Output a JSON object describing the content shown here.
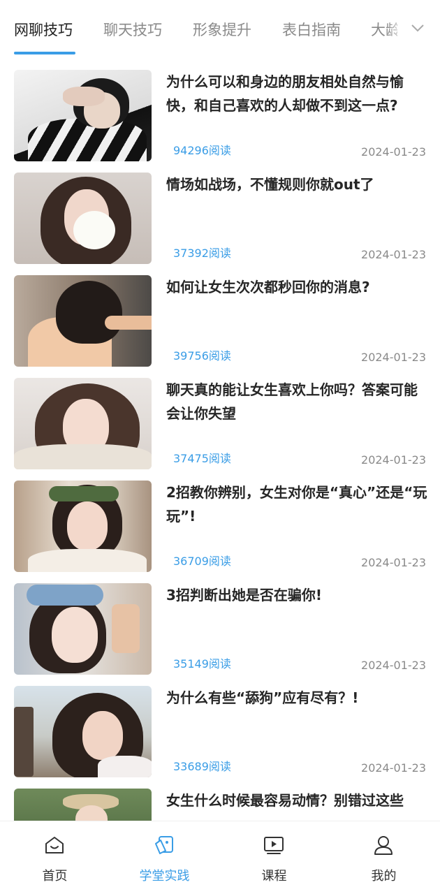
{
  "tabs": {
    "items": [
      "网聊技巧",
      "聊天技巧",
      "形象提升",
      "表白指南",
      "大龄"
    ],
    "active_index": 0,
    "more_icon": "chevron-down-icon"
  },
  "articles": [
    {
      "title": "为什么可以和身边的朋友相处自然与愉快，和自己喜欢的人却做不到这一点?",
      "reads": "94296阅读",
      "date": "2024-01-23"
    },
    {
      "title": "情场如战场，不懂规则你就out了",
      "reads": "37392阅读",
      "date": "2024-01-23"
    },
    {
      "title": "如何让女生次次都秒回你的消息?",
      "reads": "39756阅读",
      "date": "2024-01-23"
    },
    {
      "title": "聊天真的能让女生喜欢上你吗？答案可能会让你失望",
      "reads": "37475阅读",
      "date": "2024-01-23"
    },
    {
      "title": "2招教你辨别，女生对你是“真心”还是“玩玩”!",
      "reads": "36709阅读",
      "date": "2024-01-23"
    },
    {
      "title": "3招判断出她是否在骗你!",
      "reads": "35149阅读",
      "date": "2024-01-23"
    },
    {
      "title": "为什么有些“舔狗”应有尽有？!",
      "reads": "33689阅读",
      "date": "2024-01-23"
    },
    {
      "title": "女生什么时候最容易动情？别错过这些",
      "reads": "",
      "date": ""
    }
  ],
  "bottom_nav": {
    "items": [
      {
        "label": "首页",
        "icon": "home-icon"
      },
      {
        "label": "学堂实践",
        "icon": "practice-icon"
      },
      {
        "label": "课程",
        "icon": "video-play-icon"
      },
      {
        "label": "我的",
        "icon": "user-icon"
      }
    ],
    "active_index": 1
  },
  "colors": {
    "accent": "#3a9de6",
    "title_text": "#262626",
    "muted_text": "#8a8a8a"
  }
}
